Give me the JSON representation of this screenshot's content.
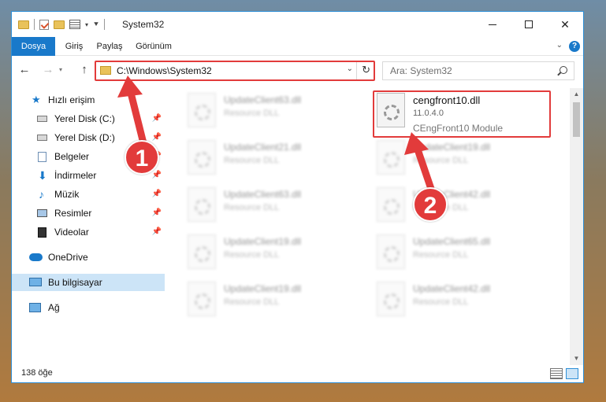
{
  "window": {
    "title": "System32"
  },
  "ribbon": {
    "tabs": [
      {
        "label": "Dosya"
      },
      {
        "label": "Giriş"
      },
      {
        "label": "Paylaş"
      },
      {
        "label": "Görünüm"
      }
    ]
  },
  "navbar": {
    "address": "C:\\Windows\\System32",
    "search_placeholder": "Ara: System32"
  },
  "sidebar": {
    "items": [
      {
        "label": "Hızlı erişim",
        "icon": "star-icon"
      },
      {
        "label": "Yerel Disk (C:)",
        "icon": "drive-icon"
      },
      {
        "label": "Yerel Disk (D:)",
        "icon": "drive-icon"
      },
      {
        "label": "Belgeler",
        "icon": "documents-icon"
      },
      {
        "label": "İndirmeler",
        "icon": "download-icon"
      },
      {
        "label": "Müzik",
        "icon": "music-icon"
      },
      {
        "label": "Resimler",
        "icon": "pictures-icon"
      },
      {
        "label": "Videolar",
        "icon": "video-icon"
      },
      {
        "label": "OneDrive",
        "icon": "cloud-icon"
      },
      {
        "label": "Bu bilgisayar",
        "icon": "computer-icon"
      },
      {
        "label": "Ağ",
        "icon": "network-icon"
      }
    ]
  },
  "files_left": [
    {
      "name": "UpdateClient63.dll",
      "desc": "Resource DLL"
    },
    {
      "name": "UpdateClient21.dll",
      "desc": "Resource DLL"
    },
    {
      "name": "UpdateClient63.dll",
      "desc": "Resource DLL"
    },
    {
      "name": "UpdateClient19.dll",
      "desc": "Resource DLL"
    },
    {
      "name": "UpdateClient19.dll",
      "desc": "Resource DLL"
    }
  ],
  "files_right": [
    {
      "name": "UpdateClient19.dll",
      "desc": "Resource DLL"
    },
    {
      "name": "UpdateClient42.dll",
      "desc": "Resource DLL"
    },
    {
      "name": "UpdateClient65.dll",
      "desc": "Resource DLL"
    },
    {
      "name": "UpdateClient42.dll",
      "desc": "Resource DLL"
    }
  ],
  "highlighted_file": {
    "name": "cengfront10.dll",
    "version": "11.0.4.0",
    "description": "CEngFront10 Module"
  },
  "status": {
    "item_count": "138 öğe"
  },
  "annotations": {
    "badge_1": "1",
    "badge_2": "2",
    "color": "#e23b3b"
  }
}
